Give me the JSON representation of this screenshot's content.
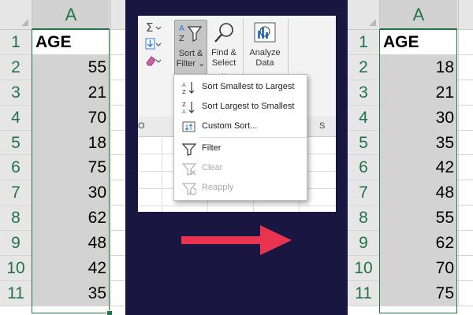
{
  "before_sheet": {
    "column_header": "A",
    "row_numbers": [
      "1",
      "2",
      "3",
      "4",
      "5",
      "6",
      "7",
      "8",
      "9",
      "10",
      "11"
    ],
    "header_cell": "AGE",
    "values": [
      "55",
      "21",
      "70",
      "18",
      "75",
      "30",
      "62",
      "48",
      "42",
      "35"
    ]
  },
  "after_sheet": {
    "column_header": "A",
    "row_numbers": [
      "1",
      "2",
      "3",
      "4",
      "5",
      "6",
      "7",
      "8",
      "9",
      "10",
      "11"
    ],
    "header_cell": "AGE",
    "values": [
      "18",
      "21",
      "30",
      "35",
      "42",
      "48",
      "55",
      "62",
      "70",
      "75"
    ]
  },
  "ribbon": {
    "sort_filter": {
      "line1": "Sort &",
      "line2": "Filter ⌄"
    },
    "find_select": {
      "line1": "Find &",
      "line2": "Select ⌄"
    },
    "analyze": {
      "line1": "Analyze",
      "line2": "Data"
    },
    "sheet_cols": {
      "left": "O",
      "right": "S"
    },
    "menu": {
      "items": [
        {
          "label": "Sort Smallest to Largest",
          "icon": "sort-ascending-icon",
          "enabled": true
        },
        {
          "label": "Sort Largest to Smallest",
          "icon": "sort-descending-icon",
          "enabled": true
        },
        {
          "label": "Custom Sort...",
          "icon": "custom-sort-icon",
          "enabled": true
        },
        {
          "label": "Filter",
          "icon": "filter-icon",
          "enabled": true
        },
        {
          "label": "Clear",
          "icon": "clear-filter-icon",
          "enabled": false
        },
        {
          "label": "Reapply",
          "icon": "reapply-icon",
          "enabled": false
        }
      ]
    }
  },
  "colors": {
    "background": "#191641",
    "excel_green": "#217346",
    "arrow": "#e8344e",
    "selected_cell": "#d3d3d3"
  }
}
